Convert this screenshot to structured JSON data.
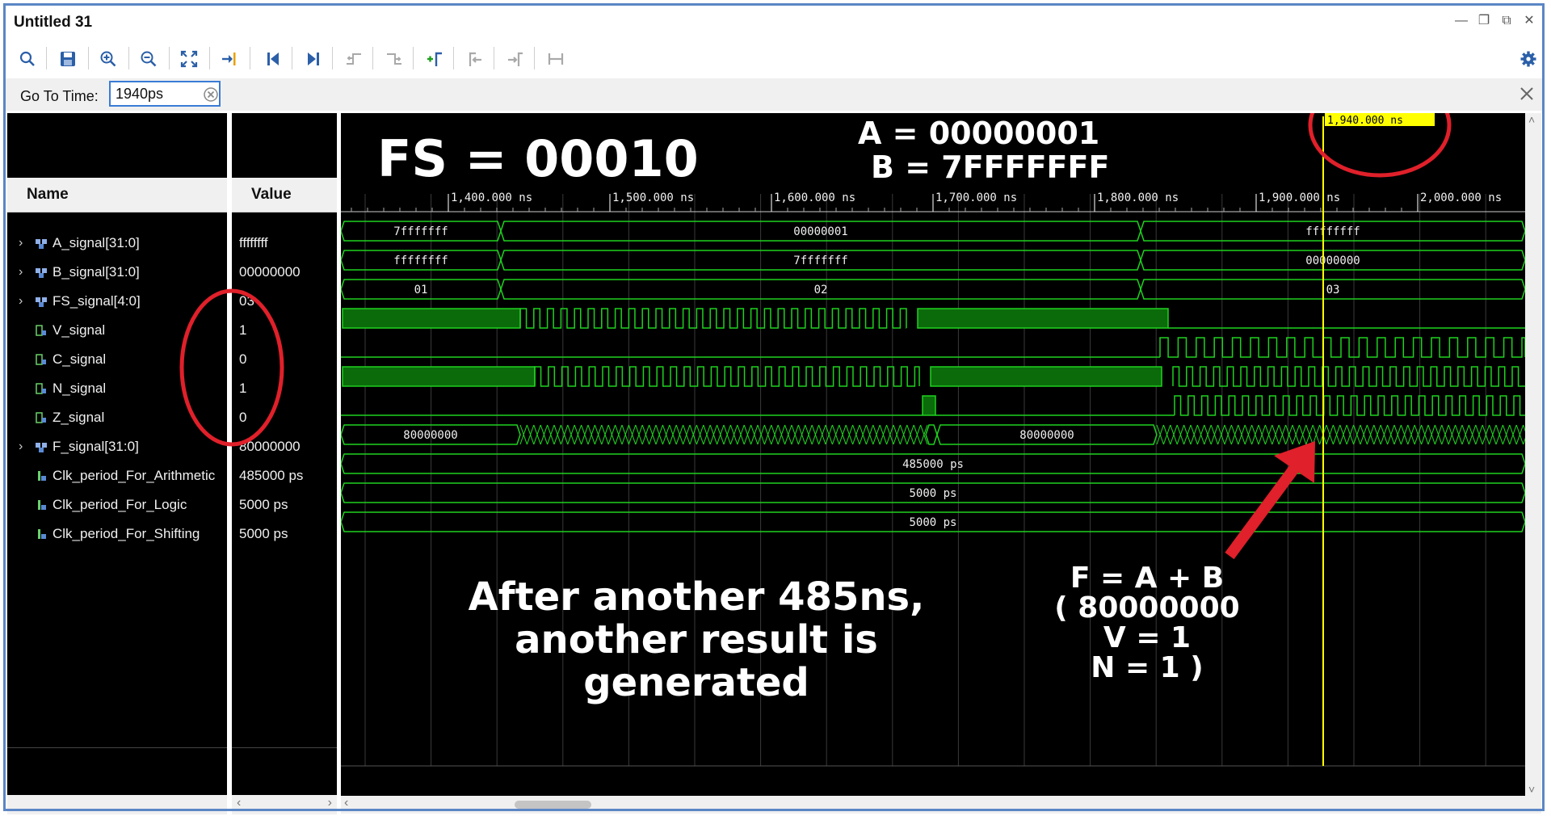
{
  "window": {
    "title": "Untitled 31"
  },
  "toolbar": {
    "icons": [
      "search-icon",
      "save-icon",
      "zoom-in-icon",
      "zoom-out-icon",
      "zoom-fit-icon",
      "go-to-cursor-icon",
      "go-to-start-icon",
      "go-to-end-icon",
      "previous-transition-icon",
      "next-transition-icon",
      "add-marker-icon",
      "previous-marker-icon",
      "next-marker-icon",
      "swap-cursors-icon",
      "settings-icon"
    ]
  },
  "goto": {
    "label": "Go To Time:",
    "value": "1940ps"
  },
  "columns": {
    "name": "Name",
    "value": "Value"
  },
  "signals": [
    {
      "name": "A_signal[31:0]",
      "value": "ffffffff",
      "type": "bus",
      "expandable": true
    },
    {
      "name": "B_signal[31:0]",
      "value": "00000000",
      "type": "bus",
      "expandable": true
    },
    {
      "name": "FS_signal[4:0]",
      "value": "03",
      "type": "bus",
      "expandable": true
    },
    {
      "name": "V_signal",
      "value": "1",
      "type": "bit",
      "expandable": false
    },
    {
      "name": "C_signal",
      "value": "0",
      "type": "bit",
      "expandable": false
    },
    {
      "name": "N_signal",
      "value": "1",
      "type": "bit",
      "expandable": false
    },
    {
      "name": "Z_signal",
      "value": "0",
      "type": "bit",
      "expandable": false
    },
    {
      "name": "F_signal[31:0]",
      "value": "80000000",
      "type": "bus",
      "expandable": true
    },
    {
      "name": "Clk_period_For_Arithmetic",
      "value": "485000 ps",
      "type": "param",
      "expandable": false
    },
    {
      "name": "Clk_period_For_Logic",
      "value": "5000 ps",
      "type": "param",
      "expandable": false
    },
    {
      "name": "Clk_period_For_Shifting",
      "value": "5000 ps",
      "type": "param",
      "expandable": false
    }
  ],
  "timeline": {
    "ticks": [
      "1,400.000 ns",
      "1,500.000 ns",
      "1,600.000 ns",
      "1,700.000 ns",
      "1,800.000 ns",
      "1,900.000 ns",
      "2,000.000 ns"
    ],
    "cursor_label": "1,940.000 ns"
  },
  "wave_labels": {
    "a": [
      "7fffffff",
      "00000001",
      "ffffffff"
    ],
    "b": [
      "ffffffff",
      "7fffffff",
      "00000000"
    ],
    "fs": [
      "01",
      "02",
      "03"
    ],
    "f": [
      "80000000",
      "80000000"
    ],
    "clk_arith": "485000 ps",
    "clk_logic": "5000 ps",
    "clk_shift": "5000 ps"
  },
  "annotations": {
    "fs_title": "FS = 00010",
    "a_value": "A = 00000001",
    "b_value": "B = 7FFFFFFF",
    "main_text": [
      "After another 485ns,",
      "another result is",
      "generated"
    ],
    "formula": [
      "F = A + B",
      "( 80000000",
      "V = 1",
      "N = 1 )"
    ]
  },
  "colors": {
    "wave": "#1fd11f",
    "wave_fill": "#0b6b0b",
    "cursor": "#ffff00",
    "grid": "#3a3a3a",
    "annotation": "#e0202a",
    "background": "#000000"
  }
}
